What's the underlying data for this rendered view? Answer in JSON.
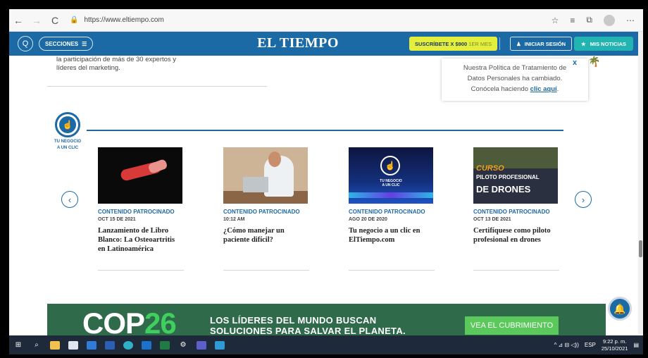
{
  "browser": {
    "url": "https://www.eltiempo.com",
    "back_glyph": "←",
    "forward_glyph": "→",
    "reload_glyph": "C",
    "lock_glyph": "🔒",
    "right_glyphs": [
      "☆",
      "≡",
      "⧉",
      "⋯"
    ]
  },
  "header": {
    "search_glyph": "Q",
    "sections_label": "SECCIONES",
    "menu_glyph": "☰",
    "logo": "EL TIEMPO",
    "subscribe_label": "SUSCRÍBETE X $900",
    "subscribe_sub": "1ER MES",
    "login_glyph": "♟",
    "login_label": "INICIAR SESIÓN",
    "news_glyph": "★",
    "news_label": "MIS NOTICIAS",
    "brand_color": "#1c6aa5"
  },
  "previous_article_text": "la participación de más de 30 expertos y líderes del marketing.",
  "popup": {
    "line1": "Nuestra Política de Tratamiento de",
    "line2": "Datos Personales ha cambiado.",
    "line3_prefix": "Conócela haciendo ",
    "link": "clic aquí",
    "line3_suffix": ".",
    "close": "x"
  },
  "section": {
    "icon_label_1": "TU NEGOCIO",
    "icon_label_2": "A UN CLIC",
    "icon_glyph": "☝"
  },
  "carousel": {
    "prev_glyph": "‹",
    "next_glyph": "›",
    "cards": [
      {
        "category": "CONTENIDO PATROCINADO",
        "date": "OCT 15 DE 2021",
        "title": "Lanzamiento de Libro Blanco: La Osteoartritis en Latinoamérica"
      },
      {
        "category": "CONTENIDO PATROCINADO",
        "date": "10:12 AM",
        "title": "¿Cómo manejar un paciente difícil?"
      },
      {
        "category": "CONTENIDO PATROCINADO",
        "date": "AGO 20 DE 2020",
        "title": "Tu negocio a un clic en ElTiempo.com",
        "thumb_text_1": "TU NEGOCIO",
        "thumb_text_2": "A UN CLIC"
      },
      {
        "category": "CONTENIDO PATROCINADO",
        "date": "OCT 13 DE 2021",
        "title": "Certifíquese como piloto profesional en drones",
        "thumb_text_1": "CURSO",
        "thumb_text_2": "PILOTO PROFESIONAL",
        "thumb_text_3": "DE DRONES"
      }
    ]
  },
  "banner": {
    "cop_white": "COP",
    "cop_green": "26",
    "line1": "LOS LÍDERES DEL MUNDO BUSCAN",
    "line2": "SOLUCIONES PARA SALVAR EL PLANETA.",
    "cta": "VEA EL CUBRIMIENTO"
  },
  "chat_glyph": "🔔",
  "taskbar": {
    "start_glyph": "⊞",
    "search_glyph": "⌕",
    "tray": "^ ⊿ ⊟ ◁))",
    "lang": "ESP",
    "time": "9:22 p. m.",
    "date": "25/10/2021",
    "notif_glyph": "▤"
  }
}
